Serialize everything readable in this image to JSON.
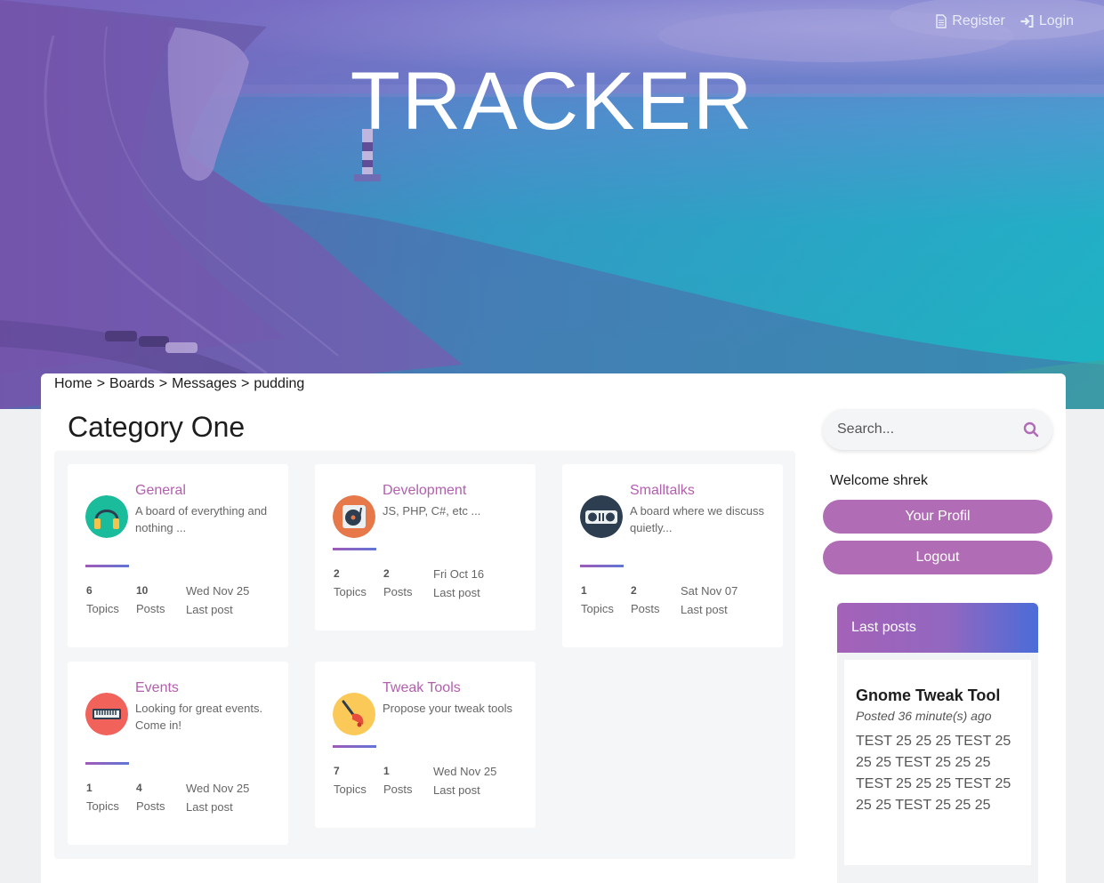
{
  "header": {
    "title": "TRACKER",
    "nav": [
      {
        "label": "Register",
        "icon": "file-icon"
      },
      {
        "label": "Login",
        "icon": "sign-in-icon"
      }
    ]
  },
  "breadcrumb": {
    "items": [
      "Home",
      "Boards",
      "Messages",
      "pudding"
    ],
    "separator": ">"
  },
  "category": {
    "title": "Category One",
    "boards": [
      {
        "name": "General",
        "description": "A board of everything and nothing ...",
        "topics": "6",
        "posts": "10",
        "last_date": "Wed Nov 25",
        "topics_label": "Topics",
        "posts_label": "Posts",
        "last_label": "Last post",
        "icon": "headphones-icon",
        "icon_color": "#1bbc9b"
      },
      {
        "name": "Development",
        "description": "JS, PHP, C#, etc ...",
        "topics": "2",
        "posts": "2",
        "last_date": "Fri Oct 16",
        "topics_label": "Topics",
        "posts_label": "Posts",
        "last_label": "Last post",
        "icon": "turntable-icon",
        "icon_color": "#e6784a"
      },
      {
        "name": "Smalltalks",
        "description": "A board where we discuss quietly...",
        "topics": "1",
        "posts": "2",
        "last_date": "Sat Nov 07",
        "topics_label": "Topics",
        "posts_label": "Posts",
        "last_label": "Last post",
        "icon": "dj-mixer-icon",
        "icon_color": "#2d3e50"
      },
      {
        "name": "Events",
        "description": "Looking for great events. Come in!",
        "topics": "1",
        "posts": "4",
        "last_date": "Wed Nov 25",
        "topics_label": "Topics",
        "posts_label": "Posts",
        "last_label": "Last post",
        "icon": "keyboard-icon",
        "icon_color": "#f0625a"
      },
      {
        "name": "Tweak Tools",
        "description": "Propose your tweak tools",
        "topics": "7",
        "posts": "1",
        "last_date": "Wed Nov 25",
        "topics_label": "Topics",
        "posts_label": "Posts",
        "last_label": "Last post",
        "icon": "bell-icon",
        "icon_color": "#fbc957"
      }
    ]
  },
  "sidebar": {
    "search_placeholder": "Search...",
    "welcome": "Welcome shrek",
    "profile_button": "Your Profil",
    "logout_button": "Logout",
    "accent": "#b06db5",
    "last_posts": {
      "title": "Last posts",
      "post": {
        "title": "Gnome Tweak Tool",
        "time": "Posted 36 minute(s) ago",
        "body": "TEST 25 25 25 TEST 25 25 25 TEST 25 25 25 TEST 25 25 25 TEST 25 25 25 TEST 25 25 25"
      }
    }
  }
}
